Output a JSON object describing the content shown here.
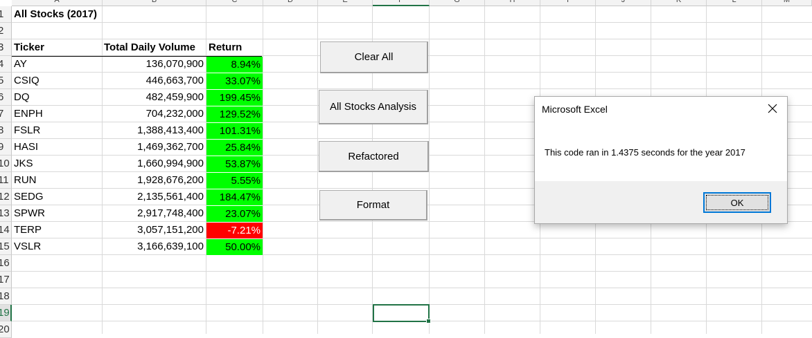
{
  "columns": [
    "A",
    "B",
    "C",
    "D",
    "E",
    "F",
    "G",
    "H",
    "I",
    "J",
    "K",
    "L",
    "M"
  ],
  "row_numbers": [
    "1",
    "2",
    "3",
    "4",
    "5",
    "6",
    "7",
    "8",
    "9",
    "10",
    "11",
    "12",
    "13",
    "14",
    "15",
    "16",
    "17",
    "18",
    "19",
    "20"
  ],
  "sheet": {
    "title": "All Stocks (2017)",
    "headers": {
      "ticker": "Ticker",
      "volume": "Total Daily Volume",
      "return": "Return"
    },
    "rows": [
      {
        "ticker": "AY",
        "volume": "136,070,900",
        "return": "8.94%",
        "status": "positive"
      },
      {
        "ticker": "CSIQ",
        "volume": "446,663,700",
        "return": "33.07%",
        "status": "positive"
      },
      {
        "ticker": "DQ",
        "volume": "482,459,900",
        "return": "199.45%",
        "status": "positive"
      },
      {
        "ticker": "ENPH",
        "volume": "704,232,000",
        "return": "129.52%",
        "status": "positive"
      },
      {
        "ticker": "FSLR",
        "volume": "1,388,413,400",
        "return": "101.31%",
        "status": "positive"
      },
      {
        "ticker": "HASI",
        "volume": "1,469,362,700",
        "return": "25.84%",
        "status": "positive"
      },
      {
        "ticker": "JKS",
        "volume": "1,660,994,900",
        "return": "53.87%",
        "status": "positive"
      },
      {
        "ticker": "RUN",
        "volume": "1,928,676,200",
        "return": "5.55%",
        "status": "positive"
      },
      {
        "ticker": "SEDG",
        "volume": "2,135,561,400",
        "return": "184.47%",
        "status": "positive"
      },
      {
        "ticker": "SPWR",
        "volume": "2,917,748,400",
        "return": "23.07%",
        "status": "positive"
      },
      {
        "ticker": "TERP",
        "volume": "3,057,151,200",
        "return": "-7.21%",
        "status": "negative"
      },
      {
        "ticker": "VSLR",
        "volume": "3,166,639,100",
        "return": "50.00%",
        "status": "positive"
      }
    ]
  },
  "buttons": {
    "clear_all": "Clear All",
    "all_stocks": "All Stocks Analysis",
    "refactored": "Refactored",
    "format": "Format"
  },
  "dialog": {
    "title": "Microsoft Excel",
    "message": "This code ran in 1.4375 seconds for the year 2017",
    "ok_label": "OK"
  },
  "colors": {
    "positive": "#00ff00",
    "negative": "#ff0000",
    "selection": "#217346",
    "focus": "#0078d7"
  },
  "icons": {
    "dialog_close": "close-icon"
  }
}
